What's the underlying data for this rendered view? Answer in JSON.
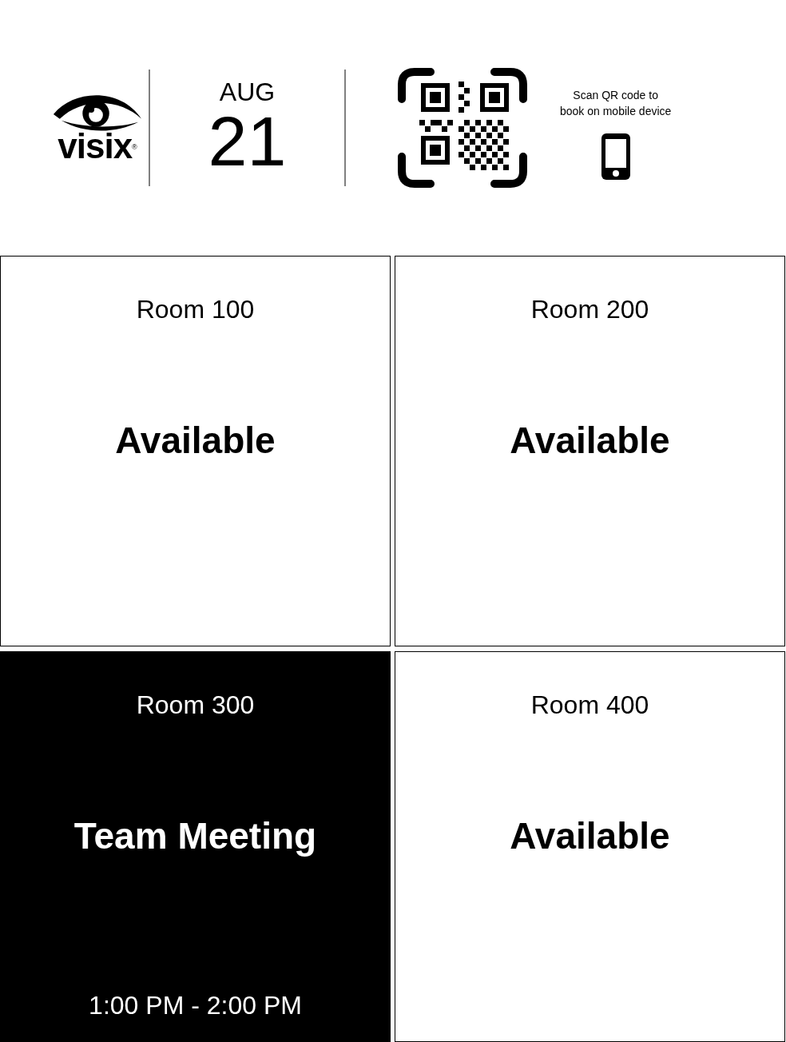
{
  "header": {
    "logo": {
      "wordmark": "visix",
      "mark": "®"
    },
    "date": {
      "month": "AUG",
      "day": "21"
    },
    "qr": {
      "caption_lines": [
        "Scan QR code to",
        "book on mobile device"
      ]
    }
  },
  "rooms": [
    {
      "name": "Room 100",
      "occupied": false,
      "status": "Available"
    },
    {
      "name": "Room 200",
      "occupied": false,
      "status": "Available"
    },
    {
      "name": "Room 300",
      "occupied": true,
      "status": "Team Meeting",
      "time": "1:00 PM - 2:00 PM"
    },
    {
      "name": "Room 400",
      "occupied": false,
      "status": "Available"
    }
  ]
}
